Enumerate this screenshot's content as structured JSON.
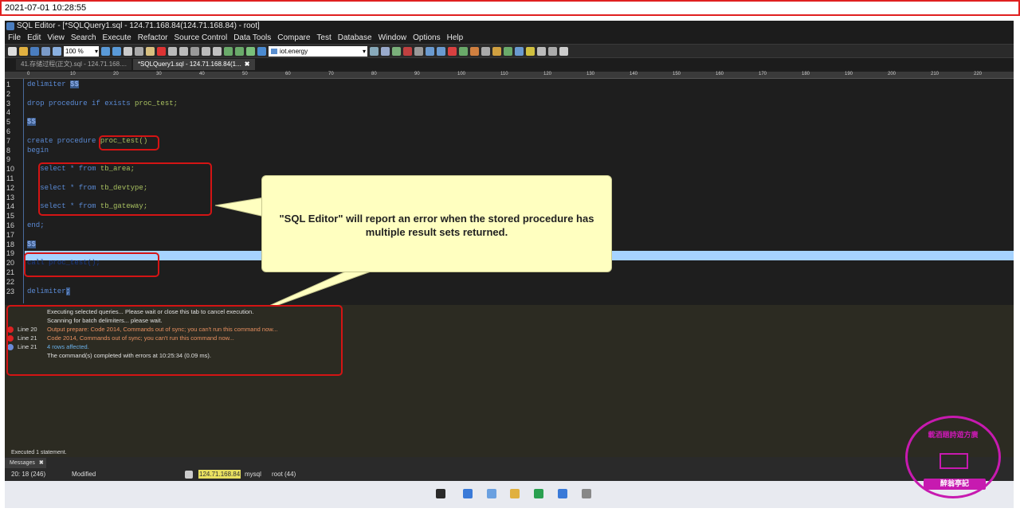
{
  "timestamp": "2021-07-01 10:28:55",
  "window": {
    "title": "SQL Editor - [*SQLQuery1.sql - 124.71.168.84(124.71.168.84) - root]"
  },
  "menu": [
    "File",
    "Edit",
    "View",
    "Search",
    "Execute",
    "Refactor",
    "Source Control",
    "Data Tools",
    "Compare",
    "Test",
    "Database",
    "Window",
    "Options",
    "Help"
  ],
  "toolbar": {
    "zoom": "100 %",
    "database": "iot.energy"
  },
  "tabs": [
    {
      "label": "41.存储过程(正文).sql - 124.71.168...."
    },
    {
      "label": "*SQLQuery1.sql - 124.71.168.84(1...",
      "close": "✖"
    }
  ],
  "ruler": [
    "0",
    "10",
    "20",
    "30",
    "40",
    "50",
    "60",
    "70",
    "80",
    "90",
    "100",
    "110",
    "120",
    "130",
    "140",
    "150",
    "160",
    "170",
    "180",
    "190",
    "200",
    "210",
    "220"
  ],
  "editor": {
    "line_numbers": [
      "1",
      "2",
      "3",
      "4",
      "5",
      "6",
      "7",
      "8",
      "9",
      "10",
      "11",
      "12",
      "13",
      "14",
      "15",
      "16",
      "17",
      "18",
      "19",
      "20",
      "21",
      "22",
      "23"
    ],
    "l1_kw": "delimiter",
    "l1_sel": "$$",
    "l3": "drop procedure if exists",
    "l3_id": "proc_test;",
    "l5_sel": "$$",
    "l7": "create procedure",
    "l7_id": "proc_test()",
    "l8": "begin",
    "l10": "select * from",
    "l10_id": "tb_area;",
    "l12": "select * from",
    "l12_id": "tb_devtype;",
    "l14": "select * from",
    "l14_id": "tb_gateway;",
    "l16": "end;",
    "l18_sel": "$$",
    "l20_kw": "call",
    "l20_id": "proc_test();",
    "l23_kw": "delimiter",
    "l23_sel": ";"
  },
  "callout": {
    "text": "\"SQL Editor\" will report an error when the stored procedure has multiple result sets returned."
  },
  "messages": [
    {
      "line": "",
      "text": "Executing selected queries... Please wait or close this tab to cancel execution.",
      "type": "plain"
    },
    {
      "line": "",
      "text": "Scanning for batch delimiters... please wait.",
      "type": "plain"
    },
    {
      "line": "Line 20",
      "text": "Output prepare: Code 2014,    Commands out of sync; you can't run this command now...",
      "type": "error"
    },
    {
      "line": "Line 21",
      "text": "Code 2014,    Commands out of sync; you can't run this command now...",
      "type": "error"
    },
    {
      "line": "Line 21",
      "text": "4  rows affected.",
      "type": "info"
    },
    {
      "line": "",
      "text": "The command(s) completed with errors at 10:25:34 (0.09 ms).",
      "type": "plain"
    }
  ],
  "status": {
    "executed": "Executed 1 statement.",
    "messages_tab": "Messages",
    "messages_close": "✖",
    "position": "20: 18 (246)",
    "modified": "Modified",
    "host": "124.71.168.84",
    "db_type": "mysql",
    "user": "root (44)"
  },
  "colors": {
    "accent": "#5b8bd6",
    "error": "#d41414",
    "callout": "#ffffc0",
    "stamp": "#c71ab0"
  },
  "stamp": {
    "arc_text": "載酒題詩遊方廣",
    "bottom_text": "醉翁亭記"
  }
}
